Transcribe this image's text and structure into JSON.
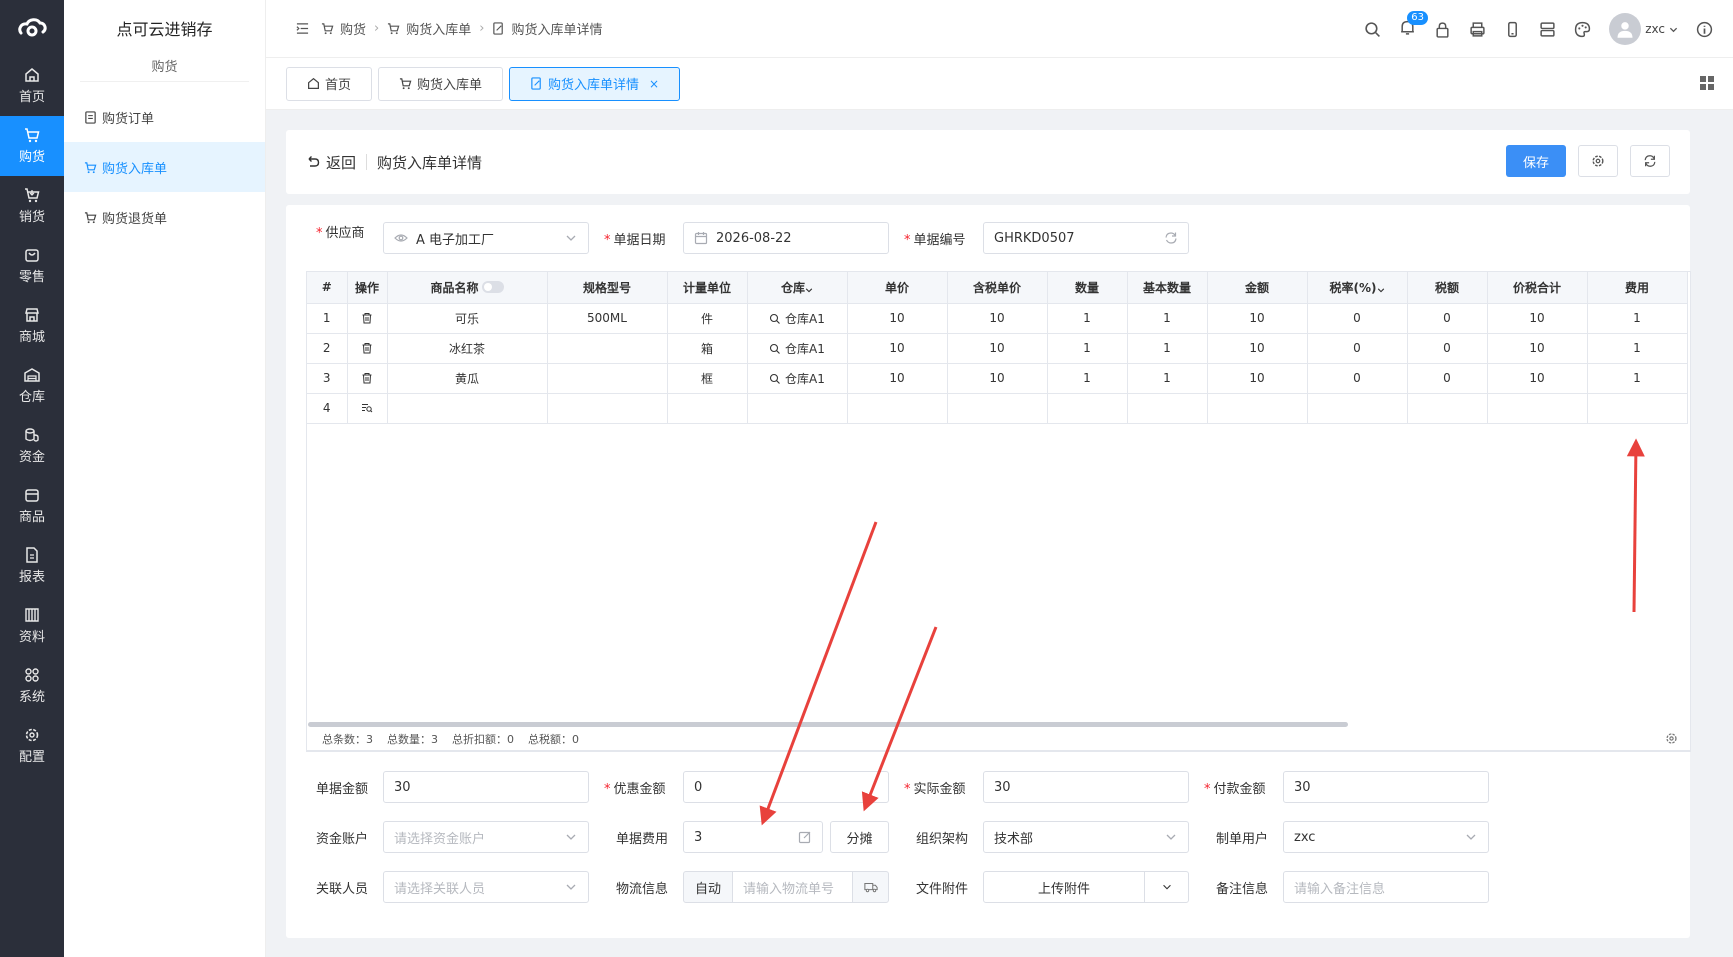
{
  "rail": {
    "items": [
      {
        "label": "首页",
        "icon": "home-icon"
      },
      {
        "label": "购货",
        "icon": "cart-icon",
        "active": true
      },
      {
        "label": "销货",
        "icon": "cart-out-icon"
      },
      {
        "label": "零售",
        "icon": "retail-icon"
      },
      {
        "label": "商城",
        "icon": "store-icon"
      },
      {
        "label": "仓库",
        "icon": "warehouse-icon"
      },
      {
        "label": "资金",
        "icon": "coins-icon"
      },
      {
        "label": "商品",
        "icon": "goods-icon"
      },
      {
        "label": "报表",
        "icon": "report-icon"
      },
      {
        "label": "资料",
        "icon": "data-icon"
      },
      {
        "label": "系统",
        "icon": "system-icon"
      },
      {
        "label": "配置",
        "icon": "config-icon"
      }
    ]
  },
  "subnav": {
    "brand": "点可云进销存",
    "section": "购货",
    "items": [
      {
        "label": "购货订单"
      },
      {
        "label": "购货入库单",
        "active": true
      },
      {
        "label": "购货退货单"
      }
    ]
  },
  "breadcrumb": {
    "items": [
      "购货",
      "购货入库单",
      "购货入库单详情"
    ]
  },
  "header": {
    "notification_count": "63",
    "username": "zxc"
  },
  "tabs": [
    {
      "label": "首页"
    },
    {
      "label": "购货入库单"
    },
    {
      "label": "购货入库单详情",
      "active": true,
      "close": "×"
    }
  ],
  "page": {
    "back_label": "返回",
    "title": "购货入库单详情",
    "save_label": "保存"
  },
  "form": {
    "supplier_label": "供应商",
    "supplier_value": "A 电子加工厂",
    "date_label": "单据日期",
    "date_value": "2026-08-22",
    "number_label": "单据编号",
    "number_value": "GHRKD0507"
  },
  "table": {
    "headers": [
      "#",
      "操作",
      "商品名称",
      "规格型号",
      "计量单位",
      "仓库",
      "单价",
      "含税单价",
      "数量",
      "基本数量",
      "金额",
      "税率(%)",
      "税额",
      "价税合计",
      "费用"
    ],
    "rows": [
      {
        "idx": "1",
        "name": "可乐",
        "spec": "500ML",
        "unit": "件",
        "warehouse": "仓库A1",
        "price": "10",
        "tax_price": "10",
        "qty": "1",
        "base_qty": "1",
        "amount": "10",
        "tax_rate": "0",
        "tax": "0",
        "total": "10",
        "fee": "1"
      },
      {
        "idx": "2",
        "name": "冰红茶",
        "spec": "",
        "unit": "箱",
        "warehouse": "仓库A1",
        "price": "10",
        "tax_price": "10",
        "qty": "1",
        "base_qty": "1",
        "amount": "10",
        "tax_rate": "0",
        "tax": "0",
        "total": "10",
        "fee": "1"
      },
      {
        "idx": "3",
        "name": "黄瓜",
        "spec": "",
        "unit": "框",
        "warehouse": "仓库A1",
        "price": "10",
        "tax_price": "10",
        "qty": "1",
        "base_qty": "1",
        "amount": "10",
        "tax_rate": "0",
        "tax": "0",
        "total": "10",
        "fee": "1"
      }
    ],
    "empty_row_idx": "4",
    "footer": {
      "total_count": "总条数：3",
      "total_qty": "总数量：3",
      "total_discount": "总折扣额：0",
      "total_tax": "总税额：0"
    }
  },
  "summary": {
    "bill_amount_label": "单据金额",
    "bill_amount": "30",
    "discount_label": "优惠金额",
    "discount": "0",
    "actual_label": "实际金额",
    "actual": "30",
    "payment_label": "付款金额",
    "payment": "30",
    "account_label": "资金账户",
    "account_placeholder": "请选择资金账户",
    "fee_label": "单据费用",
    "fee": "3",
    "allocate_label": "分摊",
    "org_label": "组织架构",
    "org": "技术部",
    "creator_label": "制单用户",
    "creator": "zxc",
    "related_label": "关联人员",
    "related_placeholder": "请选择关联人员",
    "logistics_label": "物流信息",
    "logistics_auto": "自动",
    "logistics_placeholder": "请输入物流单号",
    "attachment_label": "文件附件",
    "attachment_button": "上传附件",
    "remark_label": "备注信息",
    "remark_placeholder": "请输入备注信息"
  },
  "colors": {
    "accent": "#1890ff",
    "rail_bg": "#2b2f3a",
    "arrow": "#e8413c"
  }
}
